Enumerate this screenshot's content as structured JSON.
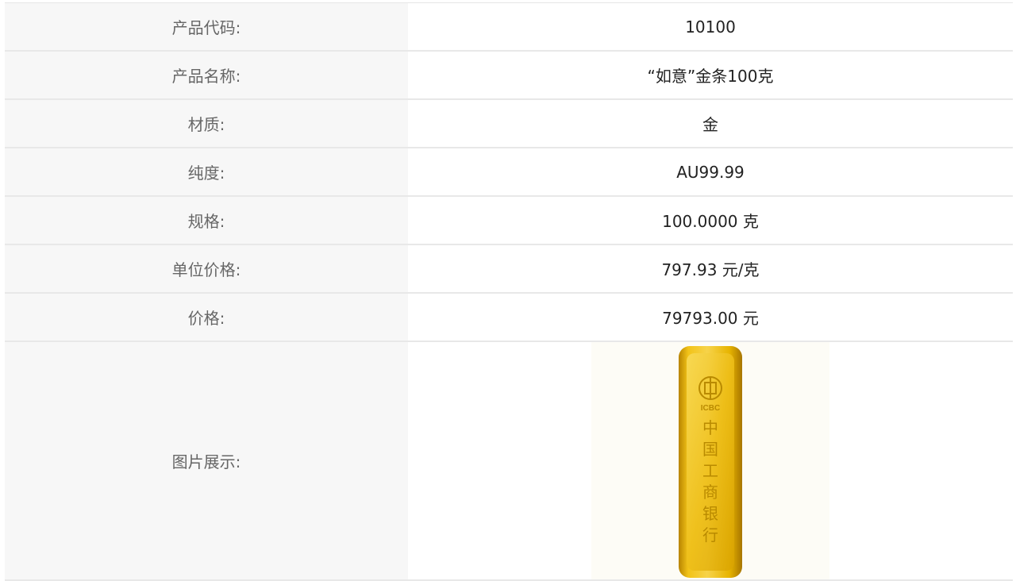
{
  "rows": [
    {
      "label": "产品代码:",
      "value": "10100"
    },
    {
      "label": "产品名称:",
      "value": "“如意”金条100克"
    },
    {
      "label": "材质:",
      "value": "金"
    },
    {
      "label": "纯度:",
      "value": "AU99.99"
    },
    {
      "label": "规格:",
      "value": "100.0000 克"
    },
    {
      "label": "单位价格:",
      "value": "797.93 元/克"
    },
    {
      "label": "价格:",
      "value": "79793.00 元"
    }
  ],
  "image_row": {
    "label": "图片展示:",
    "bar_brand": "ICBC",
    "bar_text": [
      "中",
      "国",
      "工",
      "商",
      "银",
      "行"
    ]
  },
  "colors": {
    "label_bg": "#f7f7f7",
    "gold_light": "#f7d34a",
    "gold_mid": "#e7b400",
    "gold_dark": "#b88400"
  }
}
